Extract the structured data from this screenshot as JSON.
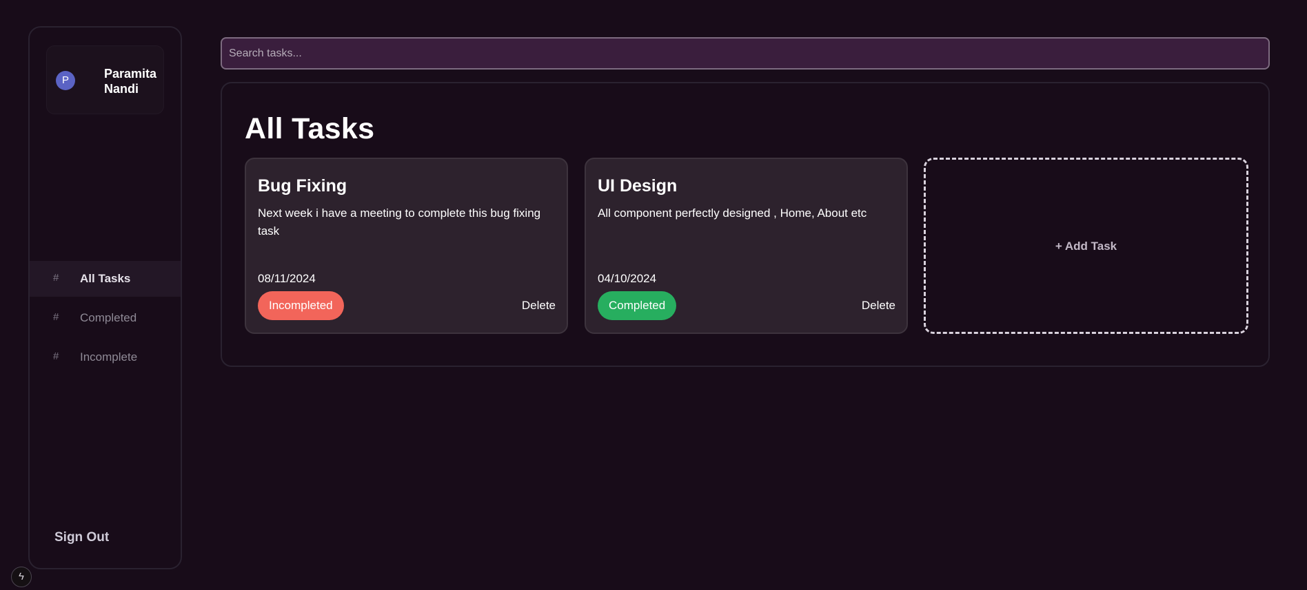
{
  "user": {
    "initial": "P",
    "name": "Paramita Nandi"
  },
  "nav": {
    "items": [
      {
        "icon": "#",
        "label": "All Tasks",
        "active": true
      },
      {
        "icon": "#",
        "label": "Completed",
        "active": false
      },
      {
        "icon": "#",
        "label": "Incomplete",
        "active": false
      }
    ],
    "sign_out": "Sign Out"
  },
  "search": {
    "placeholder": "Search tasks...",
    "value": ""
  },
  "main": {
    "title": "All Tasks",
    "tasks": [
      {
        "title": "Bug Fixing",
        "description": "Next week i have a meeting to complete this bug fixing task",
        "date": "08/11/2024",
        "status": "Incompleted",
        "status_color": "#f2655a",
        "delete_label": "Delete"
      },
      {
        "title": "UI Design",
        "description": "All component perfectly designed , Home, About etc",
        "date": "04/10/2024",
        "status": "Completed",
        "status_color": "#27ae5f",
        "delete_label": "Delete"
      }
    ],
    "add_task_label": "+ Add Task"
  },
  "footer_badge_icon": "lightning-icon",
  "colors": {
    "background": "#180c19",
    "search_background": "#3a1e3d",
    "card_background": "#2d222d",
    "incomplete": "#f2655a",
    "complete": "#27ae5f"
  }
}
